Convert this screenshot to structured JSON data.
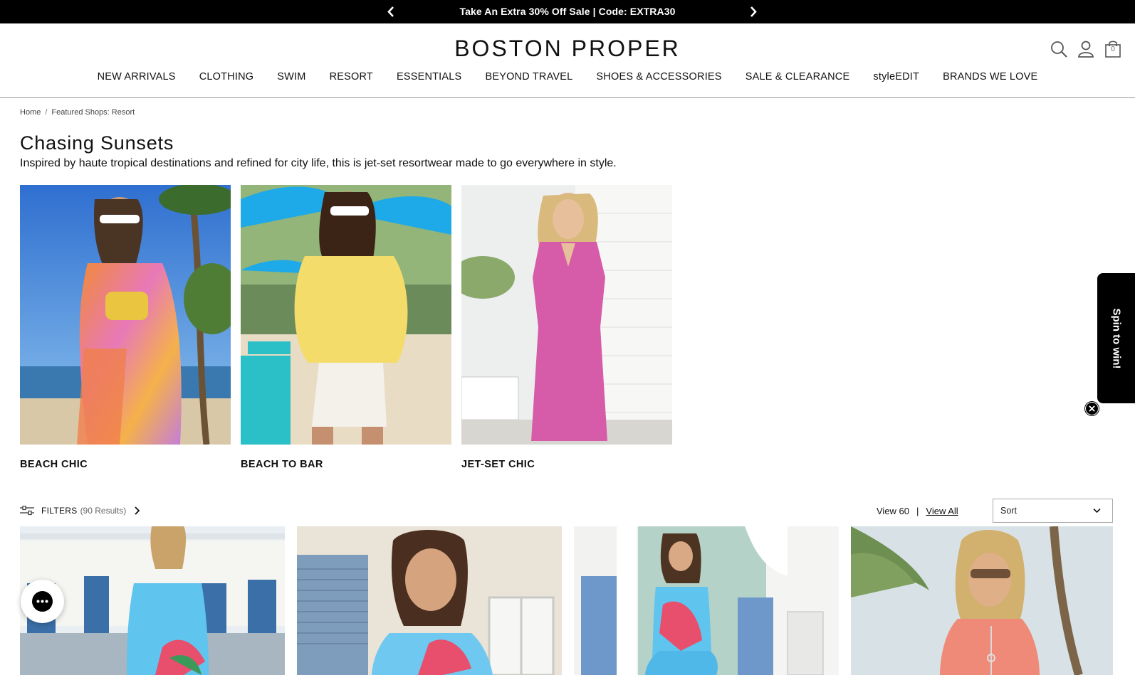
{
  "promo": {
    "text": "Take An Extra 30% Off Sale | Code: EXTRA30",
    "prev_icon": "chevron-left-icon",
    "next_icon": "chevron-right-icon"
  },
  "header": {
    "logo": "BOSTON PROPER",
    "icons": [
      "search-icon",
      "account-icon",
      "shopping-bag-icon"
    ],
    "bag_count": "0"
  },
  "nav": {
    "items": [
      "NEW ARRIVALS",
      "CLOTHING",
      "SWIM",
      "RESORT",
      "ESSENTIALS",
      "BEYOND TRAVEL",
      "SHOES & ACCESSORIES",
      "SALE & CLEARANCE",
      "styleEDIT",
      "BRANDS WE LOVE"
    ]
  },
  "breadcrumb": {
    "home": "Home",
    "separator": "/",
    "current": "Featured Shops: Resort"
  },
  "page": {
    "title": "Chasing Sunsets",
    "description": "Inspired by haute tropical destinations and refined for city life, this is jet-set resortwear made to go everywhere in style."
  },
  "feature_tiles": [
    {
      "label": "BEACH CHIC"
    },
    {
      "label": "BEACH TO BAR"
    },
    {
      "label": "JET-SET CHIC"
    }
  ],
  "spin": {
    "label": "Spin to win!",
    "close_icon": "close-icon"
  },
  "toolbar": {
    "filters_label": "FILTERS",
    "results": "(90 Results)",
    "view_60": "View 60",
    "divider": "|",
    "view_all": "View All",
    "sort_label": "Sort"
  },
  "chat": {
    "icon": "chat-icon"
  },
  "colors": {
    "promo_bg": "#000000",
    "text": "#111111",
    "sky_blue": "#5aa9dd",
    "dress_blue": "#5fc4ee",
    "pink_dress": "#d65ba8",
    "coral_top": "#ef8a78",
    "yellow_sweater": "#f3dc6a"
  }
}
